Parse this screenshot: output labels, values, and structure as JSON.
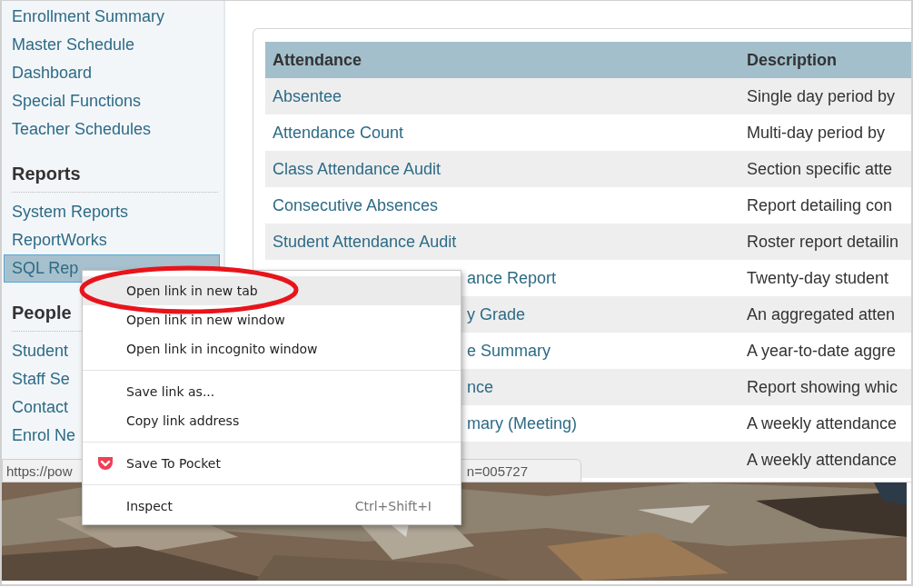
{
  "sidebar": {
    "sections": [
      {
        "items": [
          {
            "label": "Enrollment Summary",
            "selected": false
          },
          {
            "label": "Master Schedule",
            "selected": false
          },
          {
            "label": "Dashboard",
            "selected": false
          },
          {
            "label": "Special Functions",
            "selected": false
          },
          {
            "label": "Teacher Schedules",
            "selected": false
          }
        ]
      },
      {
        "heading": "Reports",
        "items": [
          {
            "label": "System Reports",
            "selected": false
          },
          {
            "label": "ReportWorks",
            "selected": false
          },
          {
            "label": "SQL Rep",
            "selected": true
          }
        ]
      },
      {
        "heading": "People",
        "items": [
          {
            "label": "Student",
            "selected": false
          },
          {
            "label": "Staff Se",
            "selected": false
          },
          {
            "label": "Contact",
            "selected": false
          },
          {
            "label": "Enrol Ne",
            "selected": false
          }
        ]
      }
    ]
  },
  "table": {
    "columns": [
      "Attendance",
      "Description"
    ],
    "rows": [
      {
        "kind": "full",
        "attendance": "Absentee",
        "description": "Single day period by"
      },
      {
        "kind": "full",
        "attendance": "Attendance Count",
        "description": "Multi-day period by"
      },
      {
        "kind": "full",
        "attendance": "Class Attendance Audit",
        "description": "Section specific atte"
      },
      {
        "kind": "full",
        "attendance": "Consecutive Absences",
        "description": "Report detailing con"
      },
      {
        "kind": "full",
        "attendance": "Student Attendance Audit",
        "description": "Roster report detailin"
      },
      {
        "kind": "tail",
        "attendance": "ance Report",
        "description": "Twenty-day student"
      },
      {
        "kind": "tail",
        "attendance": "y Grade",
        "description": "An aggregated atten"
      },
      {
        "kind": "tail",
        "attendance": "e Summary",
        "description": "A year-to-date aggre"
      },
      {
        "kind": "tail",
        "attendance": "nce",
        "description": "Report showing whic"
      },
      {
        "kind": "tail",
        "attendance": "mary (Meeting)",
        "description": "A weekly attendance"
      },
      {
        "kind": "tail",
        "description": "A weekly attendance"
      }
    ]
  },
  "status_bar": {
    "url_start": "https://pow",
    "url_end": "n=005727"
  },
  "context_menu": {
    "groups": [
      [
        {
          "kind": "plain",
          "label": "Open link in new tab",
          "highlighted": true
        },
        {
          "kind": "plain",
          "label": "Open link in new window",
          "highlighted": false
        },
        {
          "kind": "plain",
          "label": "Open link in incognito window",
          "highlighted": false
        }
      ],
      [
        {
          "kind": "plain",
          "label": "Save link as...",
          "highlighted": false
        },
        {
          "kind": "plain",
          "label": "Copy link address",
          "highlighted": false
        }
      ],
      [
        {
          "kind": "extension",
          "label": "Save To Pocket",
          "highlighted": false
        }
      ],
      [
        {
          "kind": "plain",
          "label": "Inspect",
          "shortcut": "Ctrl+Shift+I",
          "highlighted": false
        }
      ]
    ]
  }
}
